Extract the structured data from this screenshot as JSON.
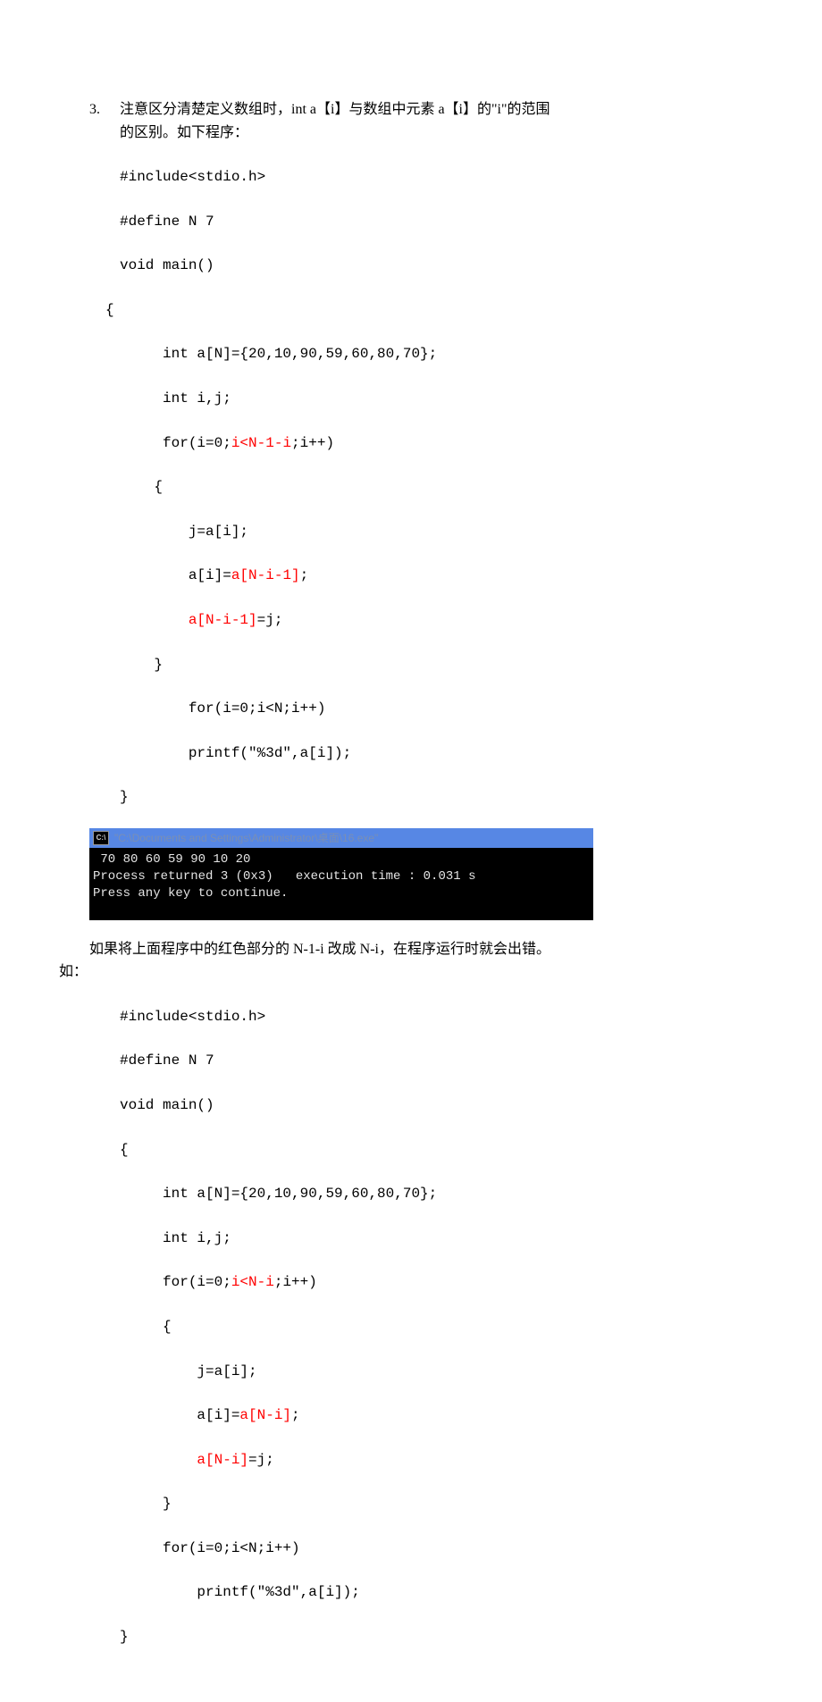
{
  "item": {
    "number": "3.",
    "intro_line1": "注意区分清楚定义数组时，int a【i】与数组中元素 a【i】的\"i\"的范围",
    "intro_line2": "的区别。如下程序：",
    "code1": {
      "l1": "#include<stdio.h>",
      "l2": "#define N 7",
      "l3": "void main()",
      "l4": "{",
      "l5": "     int a[N]={20,10,90,59,60,80,70};",
      "l6": "     int i,j;",
      "l7_a": "     for(i=0;",
      "l7_b": "i<N-1-i",
      "l7_c": ";i++)",
      "l8": "    {",
      "l9": "        j=a[i];",
      "l10_a": "        a[i]=",
      "l10_b": "a[N-i-1]",
      "l10_c": ";",
      "l11_a": "        ",
      "l11_b": "a[N-i-1]",
      "l11_c": "=j;",
      "l12": "    }",
      "l13": "        for(i=0;i<N;i++)",
      "l14": "        printf(\"%3d\",a[i]);",
      "l15": "}"
    },
    "terminal": {
      "title_path": "\"C:\\Documents and Settings\\Administrator\\桌面\\16.exe\"",
      "cmd_label": "C:\\",
      "line1": " 70 80 60 59 90 10 20",
      "line2": "Process returned 3 (0x3)   execution time : 0.031 s",
      "line3": "Press any key to continue."
    },
    "after_para_indented": "    如果将上面程序中的红色部分的 N-1-i 改成 N-i，在程序运行时就会出错。",
    "after_para_out": "如：",
    "code2": {
      "l1": "#include<stdio.h>",
      "l2": "#define N 7",
      "l3": "void main()",
      "l4": "{",
      "l5": "     int a[N]={20,10,90,59,60,80,70};",
      "l6": "     int i,j;",
      "l7_a": "     for(i=0;",
      "l7_b": "i<N-i",
      "l7_c": ";i++)",
      "l8": "     {",
      "l9": "         j=a[i];",
      "l10_a": "         a[i]=",
      "l10_b": "a[N-i]",
      "l10_c": ";",
      "l11_a": "         ",
      "l11_b": "a[N-i]",
      "l11_c": "=j;",
      "l12": "     }",
      "l13": "     for(i=0;i<N;i++)",
      "l14": "         printf(\"%3d\",a[i]);",
      "l15": "}"
    }
  }
}
